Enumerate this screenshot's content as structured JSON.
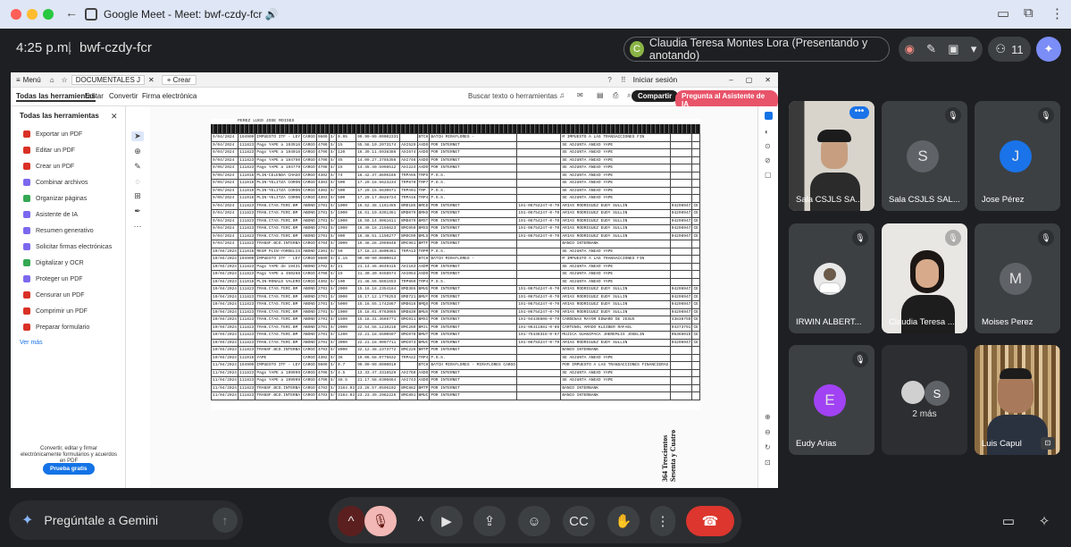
{
  "window": {
    "title": "Google Meet - Meet: bwf-czdy-fcr 🔊",
    "tab_close_glyph": "✕"
  },
  "meet": {
    "time": "4:25 p.m.",
    "meeting_code": "bwf-czdy-fcr",
    "presenter_initial": "C",
    "presenter_text": "Claudia Teresa Montes Lora (Presentando y anotando)",
    "participants_count": "11"
  },
  "pdf": {
    "menu_label": "Menú",
    "tab_label": "DOCUMENTALES J",
    "create_label": "+ Crear",
    "signin_label": "Iniciar sesión",
    "nav": [
      "Todas las herramientas",
      "Editar",
      "Convertir",
      "Firma electrónica"
    ],
    "search_placeholder": "Buscar texto o herramientas",
    "share_label": "Compartir",
    "ai_label": "Pregunta al Asistente de IA",
    "panel_title": "Todas las herramientas",
    "tools": [
      {
        "label": "Exportar un PDF",
        "color": "#d93025"
      },
      {
        "label": "Editar un PDF",
        "color": "#d93025"
      },
      {
        "label": "Crear un PDF",
        "color": "#d93025"
      },
      {
        "label": "Combinar archivos",
        "color": "#7b68ee"
      },
      {
        "label": "Organizar páginas",
        "color": "#34a853"
      },
      {
        "label": "Asistente de IA",
        "color": "#7b68ee"
      },
      {
        "label": "Resumen generativo",
        "color": "#7b68ee"
      },
      {
        "label": "Solicitar firmas electrónicas",
        "color": "#7b68ee"
      },
      {
        "label": "Digitalizar y OCR",
        "color": "#34a853"
      },
      {
        "label": "Proteger un PDF",
        "color": "#7b68ee"
      },
      {
        "label": "Censurar un PDF",
        "color": "#d93025"
      },
      {
        "label": "Comprimir un PDF",
        "color": "#d93025"
      },
      {
        "label": "Preparar formulario",
        "color": "#d93025"
      }
    ],
    "see_more": "Ver más",
    "promo_text": "Convertir, editar y firmar electrónicamente formularios y acuerdos en PDF",
    "trial_label": "Prueba gratis",
    "page_current": "229",
    "page_total": "253",
    "ledger_header": "PEREZ LUGO JOSE MOISES",
    "ledger_rows": [
      [
        "9/04/2024",
        "194909",
        "IMPUESTO ITF - LEY",
        "CARGO",
        "9609",
        "S/",
        "0.95",
        "99.99-99.00002331",
        "",
        "BTCH",
        "BATCH MIRAFLORES -",
        "",
        "M IMPUESTO A LAS TRANSACCIONES FIN",
        "",
        ""
      ],
      [
        "9/04/2024",
        "111823",
        "Pago YAPE a 193916",
        "CARGO",
        "4706",
        "S/",
        "15",
        "55.58.10.2073174",
        "AXI529",
        "AXDO",
        "POR INTERNET",
        "",
        "SE ADJUNTA ANEXO YAPE",
        "",
        ""
      ],
      [
        "9/04/2024",
        "111823",
        "Pago YAPE a 194018",
        "CARGO",
        "4706",
        "S/",
        "120",
        "16.39.11.6938386",
        "AXI674",
        "AXDO",
        "POR INTERNET",
        "",
        "SE ADJUNTA ANEXO YAPE",
        "",
        ""
      ],
      [
        "9/04/2024",
        "111823",
        "Pago YAPE a 194750",
        "CARGO",
        "4706",
        "S/",
        "45",
        "14.09.27.3785356",
        "AXI746",
        "AXDO",
        "POR INTERNET",
        "",
        "SE ADJUNTA ANEXO YAPE",
        "",
        ""
      ],
      [
        "9/05/2024",
        "111823",
        "Pago YAPE a 194779",
        "CARGO",
        "4708",
        "S/",
        "15",
        "14.45.40.5998512",
        "AXI224",
        "AXDO",
        "POR INTERNET",
        "",
        "SE ADJUNTA ANEXO YAPE",
        "",
        ""
      ],
      [
        "9/05/2024",
        "111016",
        "PLIN-CELENDA CHAGO",
        "CARGO",
        "4302",
        "S/",
        "74",
        "16.42.37.8695165",
        "TRPA55",
        "TRPS",
        "P.O.S.",
        "",
        "SE ADJUNTA ANEXO YAPE",
        "",
        ""
      ],
      [
        "9/05/2024",
        "111016",
        "PLIN-YELITZA CORON",
        "CARGO",
        "4303",
        "S/",
        "500",
        "17.29.18.5623234",
        "TRP870",
        "TRP7",
        "P.O.S.",
        "",
        "SE ADJUNTA ANEXO YAPE",
        "",
        ""
      ],
      [
        "9/05/2024",
        "111016",
        "PLIN-YELITZA CORON",
        "CARGO",
        "4302",
        "S/",
        "500",
        "17.29.15.5630571",
        "TRPA01",
        "TRP.",
        "P.O.S.",
        "",
        "SE ADJUNTA ANEXO YAPE",
        "",
        ""
      ],
      [
        "9/05/2024",
        "111016",
        "PLIN-YELITZA CORON",
        "CARGO",
        "4303",
        "S/",
        "500",
        "17.29.17.8828724",
        "TRPA16",
        "TRP4",
        "P.O.S.",
        "",
        "SE ADJUNTA ANEXO YAPE",
        "",
        ""
      ],
      [
        "9/04/2024",
        "111823",
        "TRAN.CTAS.TERC.BM",
        "ABONO",
        "2701",
        "S/",
        "1000",
        "16.52.38.1161455",
        "BMD185",
        "BMCD",
        "POR INTERNET",
        "191-06754247-0-70",
        "ARIAS RODRIGUEZ EUDY SULLIN",
        "04296947",
        "CE"
      ],
      [
        "9/04/2024",
        "111823",
        "TRAN.CTAS.TERC.BM",
        "ABONO",
        "2701",
        "S/",
        "1000",
        "16.51.10.8361361",
        "BMD079",
        "BMHS",
        "POR INTERNET",
        "191-06754247-0-70",
        "ARIAS RODRIGUEZ EUDY SULLIN",
        "04296947",
        "CE"
      ],
      [
        "9/04/2024",
        "111823",
        "TRAN.CTAS.TERC.BM",
        "ABONO",
        "2701",
        "S/",
        "1000",
        "16.50.14.9061611",
        "BMD879",
        "BMST",
        "POR INTERNET",
        "191-06754247-0-70",
        "ARIAS RODRIGUEZ EUDY SULLIN",
        "04296947",
        "CE"
      ],
      [
        "9/04/2024",
        "111823",
        "TRAN.CTAS.TERC.BM",
        "ABONO",
        "2701",
        "S/",
        "1000",
        "16.49.18.2156623",
        "BMC050",
        "BMSS",
        "POR INTERNET",
        "191-06754247-0-70",
        "ARIAS RODRIGUEZ EUDY SULLIN",
        "04296947",
        "CE"
      ],
      [
        "9/04/2024",
        "111823",
        "TRAN.CTAS.TERC.BM",
        "ABONO",
        "2701",
        "S/",
        "900",
        "16.48.51.1150277",
        "BMOC99",
        "BMLS",
        "POR INTERNET",
        "191-06754247-0-70",
        "ARIAS RODRIGUEZ EUDY SULLIN",
        "04296947",
        "CE"
      ],
      [
        "9/04/2024",
        "111823",
        "TRANSF.BCO.INTERBA",
        "CARGO",
        "4704",
        "S/",
        "3000",
        "19.48.28.2069848",
        "BMC961",
        "BMTF",
        "POR INTERNET",
        "",
        "BANCO INTERBANK",
        "",
        ""
      ],
      [
        "10/04/2024",
        "111016",
        "REGM PLIN-YORDELIS",
        "ABONO",
        "2301",
        "S/",
        "50",
        "17.18.23.8800361",
        "TRPA13",
        "TRPM",
        "P.O.S.",
        "",
        "SE ADJUNTA ANEXO YAPE",
        "",
        ""
      ],
      [
        "10/04/2024",
        "194909",
        "IMPUESTO ITF - LEY",
        "CARGO",
        "8609",
        "S/",
        "1.15",
        "99.99-99.0000013",
        "",
        "BTCH",
        "BATCH MIRAFLORES -",
        "",
        "M IMPUESTO A LAS TRANSACCIONES FIN",
        "",
        ""
      ],
      [
        "10/04/2024",
        "111823",
        "Pago YAPE de 19431",
        "ABONO",
        "2702",
        "S/",
        "21",
        "21.14.46.8649415",
        "AXI163",
        "AXDM",
        "POR INTERNET",
        "",
        "SE ADJUNTA ANEXO YAPE",
        "",
        ""
      ],
      [
        "10/04/2024",
        "111823",
        "Pago YAPE a 450268",
        "CARGO",
        "4706",
        "S/",
        "15",
        "21.30.30.9458574",
        "AXI054",
        "AXDO",
        "POR INTERNET",
        "",
        "SE ADJUNTA ANEXO YAPE",
        "",
        ""
      ],
      [
        "10/04/2024",
        "111016",
        "PLIN-RONALD VALERO",
        "CARGO",
        "4302",
        "S/",
        "100",
        "21.46.56.5661553",
        "TRP859",
        "TRP4",
        "P.O.S.",
        "",
        "SE ADJUNTA ANEXO YAPE",
        "",
        ""
      ],
      [
        "10/04/2024",
        "111823",
        "TRAN.CTAS.TERC.BM",
        "ABONO",
        "2701",
        "S/",
        "2000",
        "15.16.18.2354184",
        "BMD365",
        "BMUG",
        "POR INTERNET",
        "191-06754247-0-70",
        "ARIAS RODRIGUEZ EUDY SULLIN",
        "04296947",
        "CE"
      ],
      [
        "10/04/2024",
        "111823",
        "TRAN.CTAS.TERC.BM",
        "ABONO",
        "2701",
        "S/",
        "3000",
        "15.17.12.1770253",
        "BMD721",
        "BMUY",
        "POR INTERNET",
        "191-06754247-0-70",
        "ARIAS RODRIGUEZ EUDY SULLIN",
        "04296947",
        "CE"
      ],
      [
        "10/04/2024",
        "111823",
        "TRAN.CTAS.TERC.BM",
        "ABONO",
        "2701",
        "S/",
        "5000",
        "15.16.55.1742867",
        "BMD616",
        "BMQS",
        "POR INTERNET",
        "191-06754247-0-70",
        "ARIAS RODRIGUEZ EUDY SULLIN",
        "04296947",
        "CE"
      ],
      [
        "10/04/2024",
        "111823",
        "TRAN.CTAS.TERC.BM",
        "ABONO",
        "2701",
        "S/",
        "1000",
        "15.18.01.0763065",
        "BMD839",
        "BMUX",
        "POR INTERNET",
        "191-06754247-0-70",
        "ARIAS RODRIGUEZ EUDY SULLIN",
        "04296947",
        "CE"
      ],
      [
        "10/04/2024",
        "111823",
        "TRAN.CTAS.TERC.BM",
        "ABONO",
        "2701",
        "S/",
        "1500",
        "15.18.31.3669771",
        "BMC011",
        "BMSI",
        "POR INTERNET",
        "191-94436606-0-79",
        "CARDENAS MAYOR EDWARD DE JESUS",
        "43838755",
        "CE"
      ],
      [
        "10/04/2024",
        "111823",
        "TRAN.CTAS.TERC.BM",
        "ABONO",
        "2701",
        "S/",
        "2000",
        "22.54.56.1210216",
        "BMC269",
        "BMJL",
        "POR INTERNET",
        "191-96411681-0-86",
        "CARTENOL AMADO KLEIBER RAFAEL",
        "94373791",
        "CE"
      ],
      [
        "10/04/2024",
        "111823",
        "TRAN.CTAS.TERC.BM",
        "ABONO",
        "2701",
        "S/",
        "1200",
        "22.21.18.5500597",
        "BMC078",
        "BMUT",
        "POR INTERNET",
        "191-75436316-0-67",
        "MUJICA GUANIPACA JHEREMLIS JOSELIN",
        "06365015",
        "CE"
      ],
      [
        "10/04/2024",
        "111823",
        "TRAN.CTAS.TERC.BM",
        "ABONO",
        "2701",
        "S/",
        "3000",
        "22.21.18.9067711",
        "BMC073",
        "BMUC",
        "POR INTERNET",
        "191-06754247-0-70",
        "ARIAS RODRIGUEZ EUDY SULLIN",
        "04296947",
        "CE"
      ],
      [
        "10/04/2024",
        "111823",
        "TRANSF.BCO.INTERBA",
        "CARGO",
        "4703",
        "S/",
        "8000",
        "22.12.48.2373772",
        "BMC226",
        "BMTP",
        "POR INTERNET",
        "",
        "BANCO INTERBANK",
        "",
        ""
      ],
      [
        "10/04/2024",
        "111016",
        "YAPE",
        "CARGO",
        "4302",
        "S/",
        "36",
        "19.06.58.0775632",
        "TRPA22",
        "TRP4",
        "P.O.S.",
        "",
        "SE ADJUNTA ANEXO YAPE",
        "",
        ""
      ],
      [
        "11/04/2024",
        "194909",
        "IMPUESTO ITF - LEY",
        "CARGO",
        "9609",
        "S/",
        "0.7",
        "99.99-99.0000019",
        "",
        "BTCH",
        "BATCH MIRAFLORES - MIRAFLORES CARGO",
        "",
        "POR IMPUESTO A LAS TRANSACCIONES FINANCIERAS",
        "",
        ""
      ],
      [
        "11/04/2024",
        "111823",
        "Pago YAPE a 199999",
        "CARGO",
        "4706",
        "S/",
        "4.5",
        "13.33.47.3316529",
        "AXI769",
        "AXDO",
        "POR INTERNET",
        "",
        "SE ADJUNTA ANEXO YAPE",
        "",
        ""
      ],
      [
        "11/04/2024",
        "111823",
        "Pago YAPE a 199999",
        "CARGO",
        "4706",
        "S/",
        "48.5",
        "21.17.58.0306664",
        "AXI743",
        "AXDO",
        "POR INTERNET",
        "",
        "SE ADJUNTA ANEXO YAPE",
        "",
        ""
      ],
      [
        "11/04/2024",
        "111823",
        "TRANSF.BCO.INTERBA",
        "CARGO",
        "4703",
        "S/",
        "3164.03",
        "23.26.57.0596102",
        "BMC882",
        "BMTP",
        "POR INTERNET",
        "",
        "BANCO INTERBANK",
        "",
        ""
      ],
      [
        "11/04/2024",
        "111823",
        "TRANSF.BCO.INTERBA",
        "CARGO",
        "4703",
        "S/",
        "3164.03",
        "23.23.39.2982225",
        "BMC891",
        "BMUC",
        "POR INTERNET",
        "",
        "BANCO INTERBANK",
        "",
        ""
      ]
    ],
    "stamp_text": "364 Trescientos Sesenta y Cuatro"
  },
  "participants": [
    {
      "name": "Sala CSJLS SA...",
      "type": "video-man-glasses"
    },
    {
      "name": "Sala CSJLS SAL...",
      "type": "avatar",
      "initial": "S",
      "bg": "#5f6368"
    },
    {
      "name": "Jose Pérez",
      "type": "avatar",
      "initial": "J",
      "bg": "#1a73e8"
    },
    {
      "name": "IRWIN ALBERT...",
      "type": "photo"
    },
    {
      "name": "Claudia Teresa ...",
      "type": "video-woman"
    },
    {
      "name": "Moises Perez",
      "type": "avatar",
      "initial": "M",
      "bg": "#5f6368"
    },
    {
      "name": "Eudy Arias",
      "type": "avatar",
      "initial": "E",
      "bg": "#a142f4"
    },
    {
      "name": "2 más",
      "type": "more",
      "initial": "S"
    },
    {
      "name": "Luis Capul",
      "type": "video-man-bookshelf"
    }
  ],
  "gemini_prompt": "Pregúntale a Gemini"
}
